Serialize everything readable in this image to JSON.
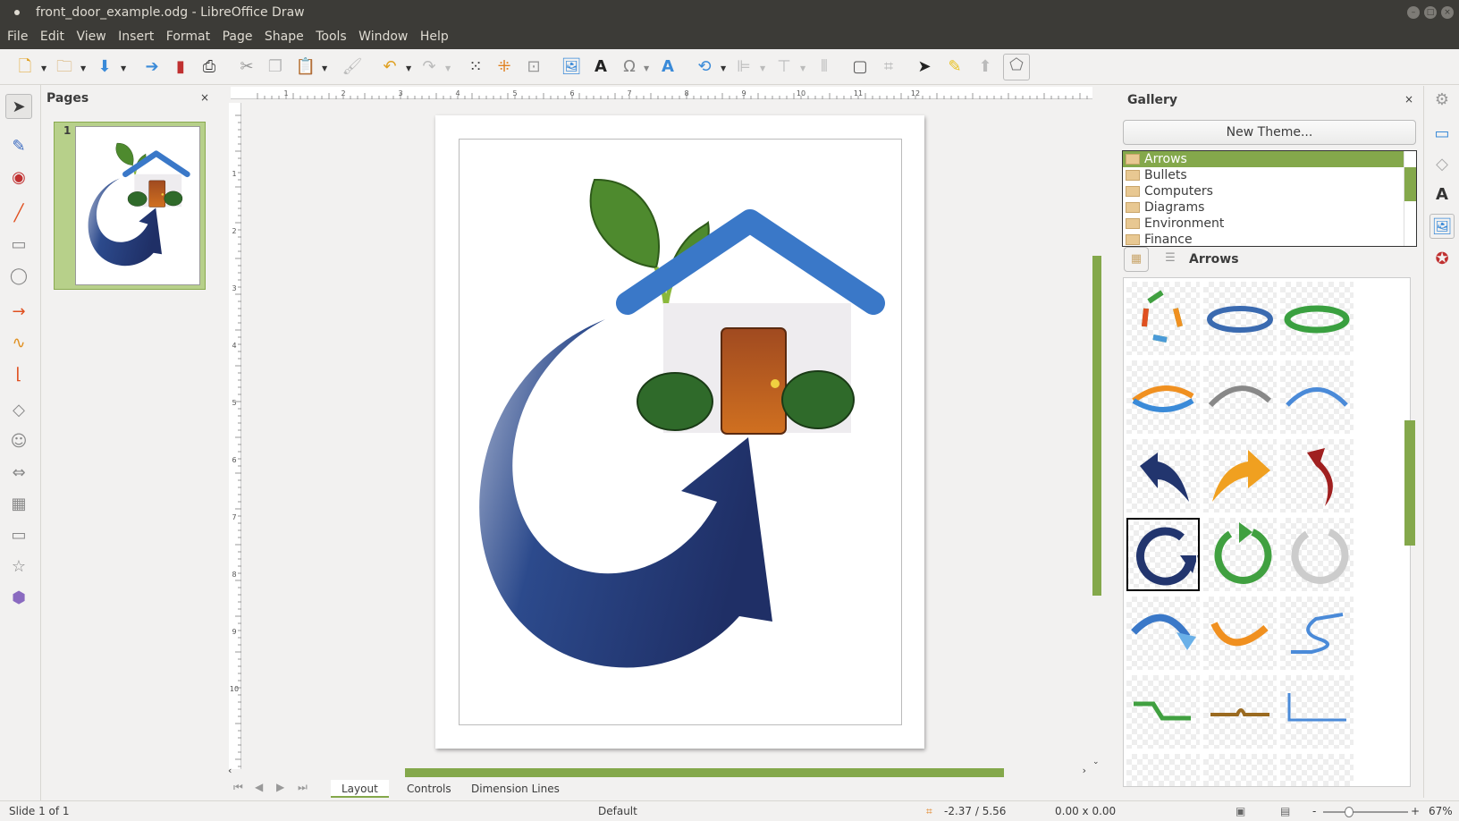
{
  "window": {
    "title": "front_door_example.odg - LibreOffice Draw"
  },
  "menu": [
    "File",
    "Edit",
    "View",
    "Insert",
    "Format",
    "Page",
    "Shape",
    "Tools",
    "Window",
    "Help"
  ],
  "pages_panel": {
    "title": "Pages",
    "close": "×",
    "page_number": "1"
  },
  "gallery": {
    "title": "Gallery",
    "close": "×",
    "new_theme_label": "New Theme...",
    "themes": [
      "Arrows",
      "Bullets",
      "Computers",
      "Diagrams",
      "Environment",
      "Finance"
    ],
    "selected_theme": "Arrows",
    "current_theme_label": "Arrows"
  },
  "ruler": {
    "h_labels": [
      "1",
      "2",
      "3",
      "4",
      "5",
      "6",
      "7",
      "8",
      "9",
      "10",
      "11",
      "12"
    ],
    "v_labels": [
      "1",
      "2",
      "3",
      "4",
      "5",
      "6",
      "7",
      "8",
      "9",
      "10"
    ]
  },
  "tabs": [
    "Layout",
    "Controls",
    "Dimension Lines"
  ],
  "status": {
    "slide": "Slide 1 of 1",
    "master": "Default",
    "position": "-2.37 / 5.56",
    "size": "0.00 x 0.00",
    "zoom": "67%"
  },
  "colors": {
    "accent": "#84a84b",
    "titlebar": "#3c3b37",
    "house_roof": "#3a78c8",
    "arrow": "#22356e"
  }
}
